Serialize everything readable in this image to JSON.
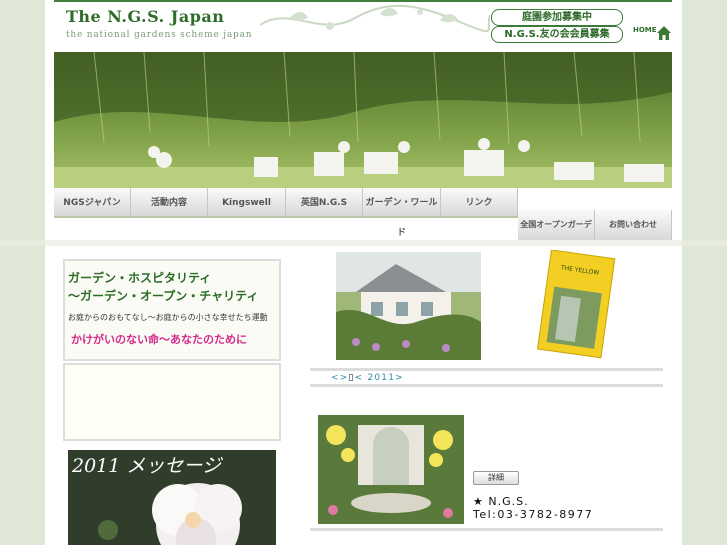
{
  "header": {
    "logo_title": "The N.G.S. Japan",
    "logo_sub": "the national gardens scheme japan",
    "pill_recruit": "庭園参加募集中",
    "pill_members": "N.G.S.友の会会員募集",
    "home": "HOME"
  },
  "nav": {
    "items": [
      "NGSジャパン",
      "活動内容",
      "Kingswell",
      "英国N.G.S",
      "ガーデン・ワールド",
      "リンク"
    ],
    "garbled": "",
    "items2": [
      "全国オープンガーデン",
      "お問い合わせ"
    ]
  },
  "left": {
    "title1": "ガーデン・ホスピタリティ",
    "title2": "〜ガーデン・オープン・チャリティ",
    "sub": "お庭からのおもてなし〜お庭からの小さな幸せたち運動",
    "pink": "かけがいのない命〜あなたのために",
    "box2_text": "",
    "message_title": "2011 メッセージ"
  },
  "main": {
    "link1": "<",
    "link_sep": ">",
    "link2": "< 2011",
    "link2_end": ">",
    "body_text": "",
    "detail_button": "詳細",
    "contact1": "★ N.G.S.",
    "contact2": "Tel:03-3782-8977"
  },
  "colors": {
    "brand_green": "#2e6d2a",
    "accent_pink": "#d42b8c",
    "link_teal": "#2d8fa6"
  }
}
